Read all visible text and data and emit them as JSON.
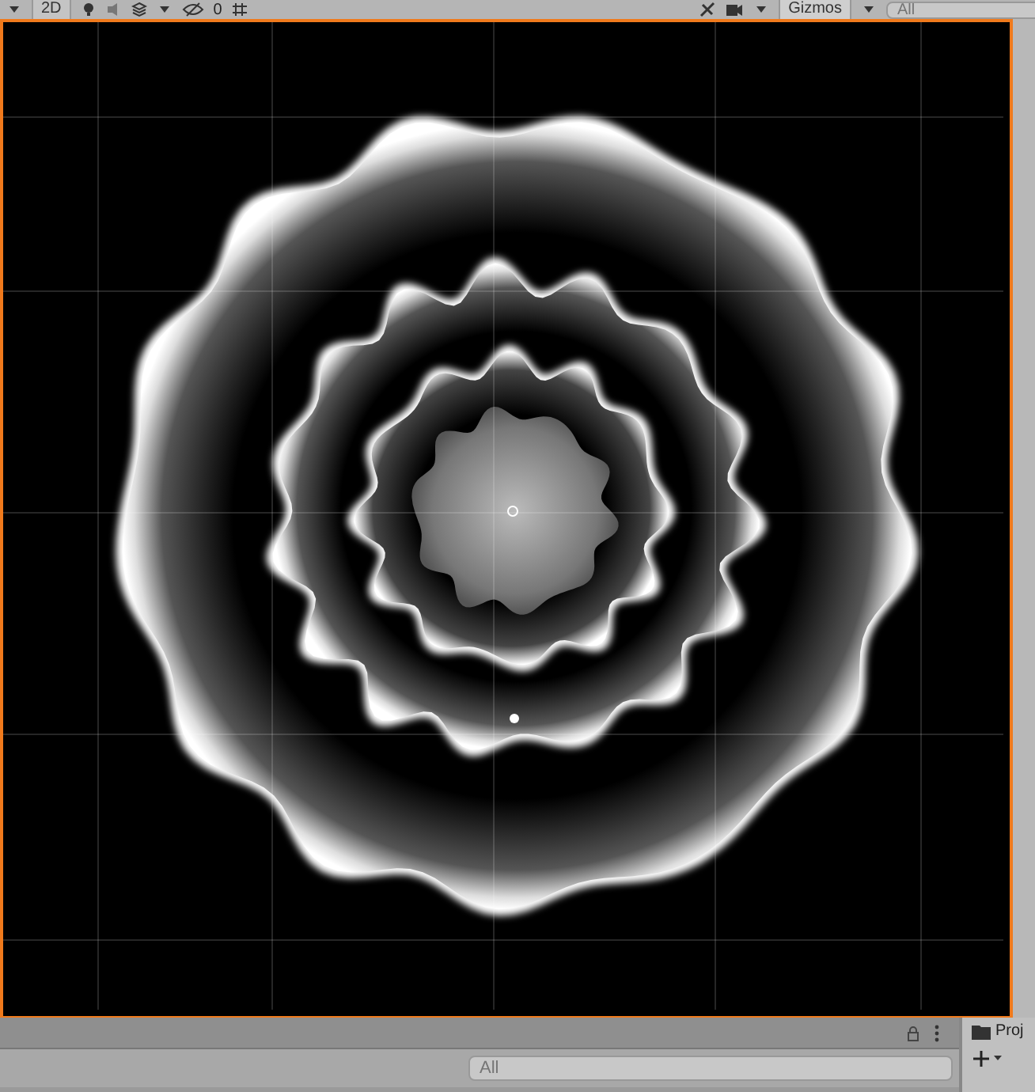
{
  "scene_toolbar": {
    "mode_button": "2D",
    "hidden_count": "0",
    "gizmos_button": "Gizmos",
    "search": {
      "placeholder": "All"
    }
  },
  "scene_view": {
    "selected": true
  },
  "hierarchy_panel": {
    "search": {
      "placeholder": "All"
    }
  },
  "project_panel": {
    "tab": "Proj"
  }
}
